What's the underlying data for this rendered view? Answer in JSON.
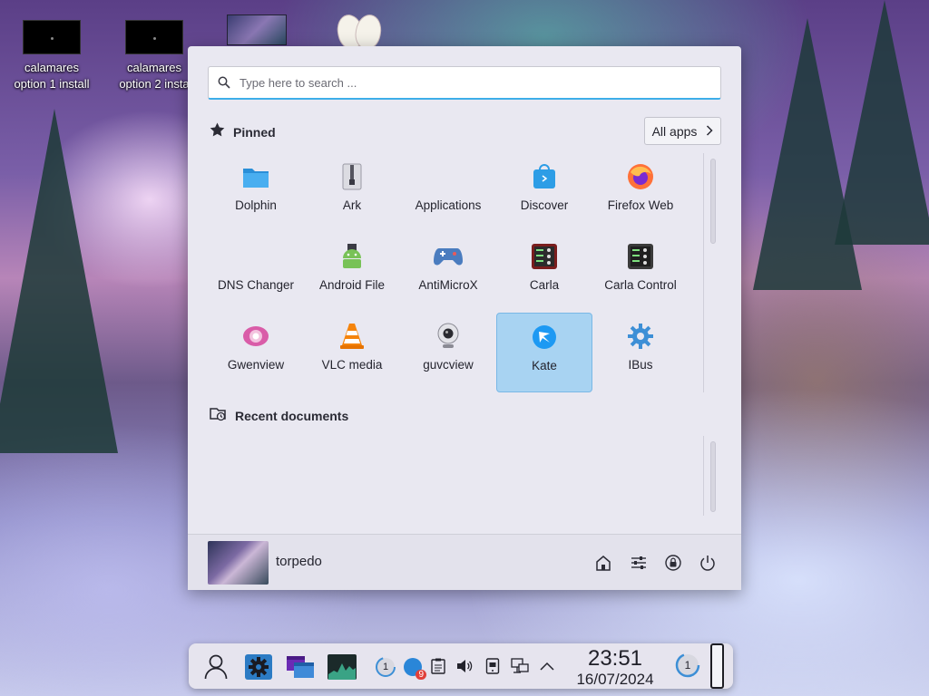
{
  "desktop": {
    "icons": [
      {
        "label_line1": "calamares",
        "label_line2": "option 1 install"
      },
      {
        "label_line1": "calamares",
        "label_line2": "option 2 insta"
      }
    ]
  },
  "launcher": {
    "search_placeholder": "Type here to search ...",
    "pinned_title": "Pinned",
    "all_apps_label": "All apps",
    "apps": [
      {
        "name": "Dolphin",
        "icon": "folder-icon"
      },
      {
        "name": "Ark",
        "icon": "archive-icon"
      },
      {
        "name": "Applications",
        "icon": "blank-icon"
      },
      {
        "name": "Discover",
        "icon": "shopping-bag-icon"
      },
      {
        "name": "Firefox Web",
        "icon": "firefox-icon"
      },
      {
        "name": "DNS Changer",
        "icon": "blank-icon"
      },
      {
        "name": "Android File",
        "icon": "android-icon"
      },
      {
        "name": "AntiMicroX",
        "icon": "gamepad-icon"
      },
      {
        "name": "Carla",
        "icon": "audio-rack-icon"
      },
      {
        "name": "Carla Control",
        "icon": "audio-rack-icon"
      },
      {
        "name": "Gwenview",
        "icon": "image-viewer-icon"
      },
      {
        "name": "VLC media",
        "icon": "traffic-cone-icon"
      },
      {
        "name": "guvcview",
        "icon": "webcam-icon"
      },
      {
        "name": "Kate",
        "icon": "kate-icon"
      },
      {
        "name": "IBus",
        "icon": "gear-icon"
      }
    ],
    "selected_app": "Kate",
    "recent_title": "Recent documents",
    "user": {
      "name": "torpedo"
    }
  },
  "taskbar": {
    "clock_time": "23:51",
    "clock_date": "16/07/2024",
    "badge_updates": "1",
    "badge_notifications": "9",
    "badge_workspace": "1"
  },
  "colors": {
    "accent": "#3daee9",
    "selection": "#a8d3f2",
    "panel_bg": "#e9e8f1"
  }
}
